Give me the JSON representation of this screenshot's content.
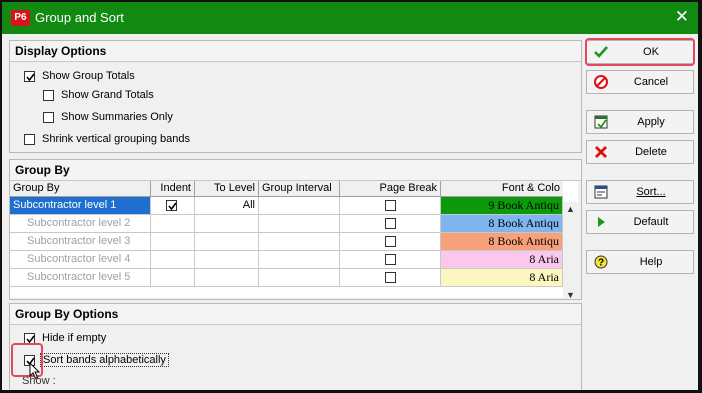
{
  "window": {
    "title": "Group and Sort",
    "app_badge": "P6",
    "close_glyph": "✕"
  },
  "display_options": {
    "heading": "Display Options",
    "items": [
      {
        "label": "Show Group Totals",
        "checked": true
      },
      {
        "label": "Show Grand Totals",
        "checked": false
      },
      {
        "label": "Show Summaries Only",
        "checked": false
      },
      {
        "label": "Shrink vertical grouping bands",
        "checked": false
      }
    ]
  },
  "group_by": {
    "heading": "Group By",
    "columns": [
      "Group By",
      "Indent",
      "To Level",
      "Group Interval",
      "Page Break",
      "Font & Colo"
    ],
    "rows": [
      {
        "group_by": "Subcontractor level 1",
        "indent": true,
        "to_level": "All",
        "interval": "",
        "page_break": false,
        "font": "9 Book Antiqu",
        "color": "#0c9a0c",
        "selected": true
      },
      {
        "group_by": "Subcontractor level 2",
        "indent": false,
        "to_level": "",
        "interval": "",
        "page_break": false,
        "font": "8 Book Antiqu",
        "color": "#7fb6f0",
        "selected": false
      },
      {
        "group_by": "Subcontractor level 3",
        "indent": false,
        "to_level": "",
        "interval": "",
        "page_break": false,
        "font": "8 Book Antiqu",
        "color": "#f7a07a",
        "selected": false
      },
      {
        "group_by": "Subcontractor level 4",
        "indent": false,
        "to_level": "",
        "interval": "",
        "page_break": false,
        "font": "8 Aria",
        "color": "#f9c8ec",
        "selected": false
      },
      {
        "group_by": "Subcontractor level 5",
        "indent": false,
        "to_level": "",
        "interval": "",
        "page_break": false,
        "font": "8 Aria",
        "color": "#fcf6c0",
        "selected": false
      }
    ]
  },
  "group_by_options": {
    "heading": "Group By Options",
    "items": [
      {
        "label": "Hide if empty",
        "checked": true
      },
      {
        "label": "Sort bands alphabetically",
        "checked": true
      }
    ],
    "show_label": "Show :"
  },
  "buttons": {
    "ok": "OK",
    "cancel": "Cancel",
    "apply": "Apply",
    "delete": "Delete",
    "sort": "Sort...",
    "default": "Default",
    "help": "Help"
  },
  "colors": {
    "titlebar": "#128a12",
    "highlight": "#e5475a",
    "selection": "#1f6fd0"
  }
}
